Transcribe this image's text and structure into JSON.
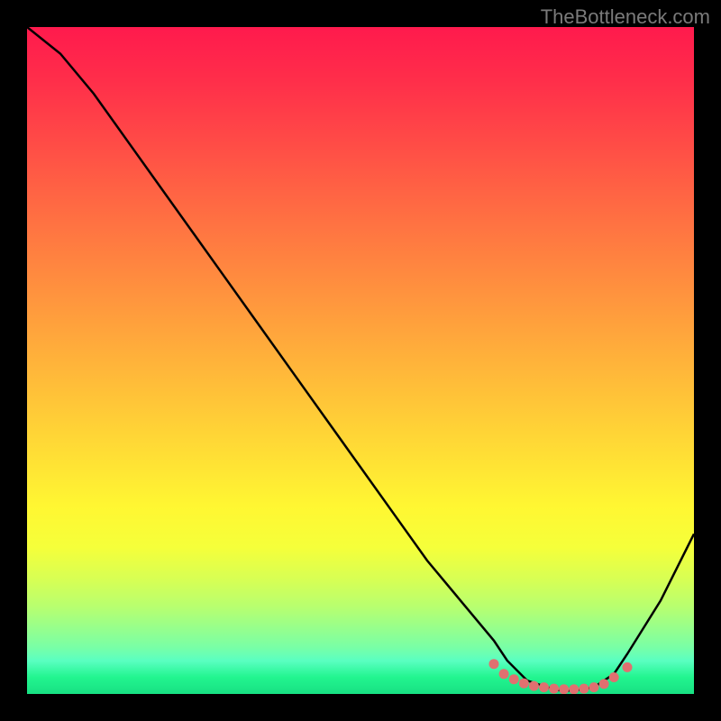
{
  "watermark": "TheBottleneck.com",
  "chart_data": {
    "type": "line",
    "title": "",
    "xlabel": "",
    "ylabel": "",
    "xlim": [
      0,
      100
    ],
    "ylim": [
      0,
      100
    ],
    "series": [
      {
        "name": "bottleneck-curve",
        "x": [
          0,
          5,
          10,
          15,
          20,
          25,
          30,
          35,
          40,
          45,
          50,
          55,
          60,
          65,
          70,
          72,
          75,
          78,
          80,
          82,
          85,
          88,
          90,
          95,
          100
        ],
        "y": [
          100,
          96,
          90,
          83,
          76,
          69,
          62,
          55,
          48,
          41,
          34,
          27,
          20,
          14,
          8,
          5,
          2,
          1,
          0.5,
          0.5,
          1,
          3,
          6,
          14,
          24
        ],
        "color": "#000000"
      }
    ],
    "markers": [
      {
        "name": "sweet-spot-dots",
        "x": [
          70,
          71.5,
          73,
          74.5,
          76,
          77.5,
          79,
          80.5,
          82,
          83.5,
          85,
          86.5,
          88,
          90
        ],
        "y": [
          4.5,
          3.0,
          2.2,
          1.6,
          1.2,
          1.0,
          0.8,
          0.7,
          0.7,
          0.8,
          1.0,
          1.5,
          2.5,
          4.0
        ],
        "color": "#e07070"
      }
    ],
    "background": {
      "type": "gradient-vertical",
      "stops": [
        {
          "pos": 0,
          "color": "#ff1a4d"
        },
        {
          "pos": 50,
          "color": "#ffb038"
        },
        {
          "pos": 80,
          "color": "#f5ff3a"
        },
        {
          "pos": 100,
          "color": "#18e083"
        }
      ]
    }
  }
}
